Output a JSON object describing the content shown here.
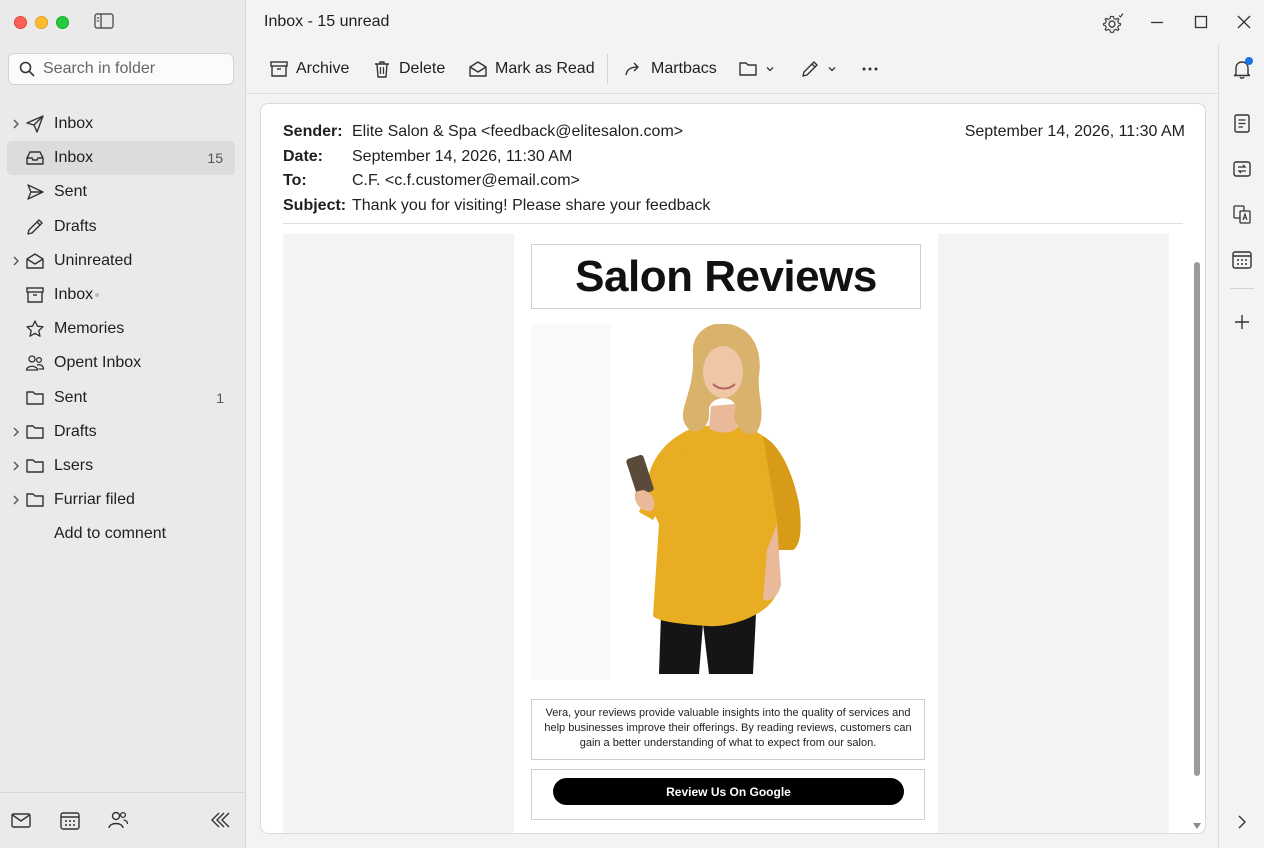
{
  "window": {
    "title": "Inbox - 15 unread"
  },
  "search": {
    "placeholder": "Search in folder"
  },
  "sidebar": {
    "folders": [
      {
        "label": "Inbox",
        "count": "",
        "icon": "send-icon"
      },
      {
        "label": "Inbox",
        "count": "15",
        "icon": "inbox-icon"
      },
      {
        "label": "Sent",
        "count": "",
        "icon": "send-icon"
      },
      {
        "label": "Drafts",
        "count": "",
        "icon": "pencil-icon"
      },
      {
        "label": "Uninreated",
        "count": "",
        "icon": "inbox-icon"
      },
      {
        "label": "Inbox",
        "count": "",
        "icon": "archive-icon"
      },
      {
        "label": "Memories",
        "count": "",
        "icon": "star-icon"
      },
      {
        "label": "Opent Inbox",
        "count": "",
        "icon": "people-icon"
      },
      {
        "label": "Sent",
        "count": "1",
        "icon": "folder-icon"
      },
      {
        "label": "Drafts",
        "count": "",
        "icon": "folder-icon"
      },
      {
        "label": "Lsers",
        "count": "",
        "icon": "folder-icon"
      },
      {
        "label": "Furriar filed",
        "count": "",
        "icon": "folder-icon"
      }
    ],
    "add_label": "Add to comnent"
  },
  "toolbar": {
    "archive_label": "Archive",
    "delete_label": "Delete",
    "mark_read_label": "Mark as Read",
    "forward_label": "Martbacs"
  },
  "message": {
    "sender_label": "Sender:",
    "sender": "Elite Salon & Spa <feedback@elitesalon.com>",
    "date_label": "Date:",
    "date": "September 14, 2026, 11:30 AM",
    "to_label": "To:",
    "to": "C.F. <c.f.customer@email.com>",
    "subject_label": "Subject:",
    "subject": "Thank you for visiting! Please share your feedback",
    "received": "September 14, 2026, 11:30 AM"
  },
  "email_body": {
    "heading": "Salon Reviews",
    "paragraph": "Vera, your reviews provide valuable insights into the quality of services and help businesses improve their offerings. By reading reviews, customers can gain a better understanding of what to expect from our salon.",
    "button_label": "Review Us On Google"
  },
  "colors": {
    "accent": "#1a73e8",
    "selected_bg": "#dcdcdc",
    "sweater": "#e8ad22"
  }
}
